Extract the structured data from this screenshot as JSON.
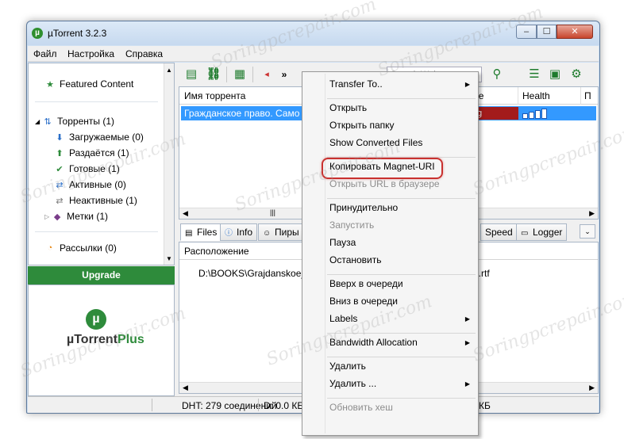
{
  "window": {
    "title": "µTorrent 3.2.3"
  },
  "window_controls": {
    "minimize": "–",
    "maximize": "☐",
    "close": "✕"
  },
  "menubar": [
    "Файл",
    "Настройка",
    "Справка"
  ],
  "sidebar": {
    "featured": "Featured Content",
    "torrents": "Торренты (1)",
    "items": [
      "Загружаемые (0)",
      "Раздаётся (1)",
      "Готовые (1)",
      "Активные (0)",
      "Неактивные (1)",
      "Метки (1)"
    ],
    "feeds": "Рассылки (0)",
    "upgrade": "Upgrade",
    "plus_logo_prefix": "µTorrent",
    "plus_logo_suffix": "Plus"
  },
  "toolbar": {
    "search_placeholder": "Search Web",
    "more": "»"
  },
  "torrent_list": {
    "columns": {
      "name": "Имя торрента",
      "status_partial": "ие",
      "health": "Health",
      "next": "П"
    },
    "row": {
      "name": "Гражданское право. Само",
      "status_partial": "g"
    },
    "health_level": 0.25
  },
  "tabs": {
    "files": "Files",
    "info": "Info",
    "peers": "Пиры",
    "speed": "Speed",
    "logger": "Logger"
  },
  "files": {
    "column": "Расположение",
    "path_start": "D:\\BOOKS\\Grajdanskoe_",
    "path_end": "e.rtf"
  },
  "statusbar": {
    "dht": "DHT: 279 соединений",
    "down": "D: 0.0 КБ",
    "up_partial": "КБ"
  },
  "context_menu": [
    {
      "label": "Transfer To..",
      "submenu": true,
      "disabled": false
    },
    {
      "sep": true
    },
    {
      "label": "Открыть",
      "disabled": false
    },
    {
      "label": "Открыть папку",
      "disabled": false
    },
    {
      "label": "Show Converted Files",
      "disabled": false
    },
    {
      "sep": true
    },
    {
      "label": "Копировать Magnet-URI",
      "disabled": false
    },
    {
      "label": "Открыть URL в браузере",
      "disabled": true
    },
    {
      "sep": true
    },
    {
      "label": "Принудительно",
      "disabled": false
    },
    {
      "label": "Запустить",
      "disabled": true
    },
    {
      "label": "Пауза",
      "disabled": false
    },
    {
      "label": "Остановить",
      "disabled": false
    },
    {
      "sep": true
    },
    {
      "label": "Вверх в очереди",
      "disabled": false
    },
    {
      "label": "Вниз в очереди",
      "disabled": false
    },
    {
      "label": "Labels",
      "submenu": true,
      "disabled": false
    },
    {
      "sep": true
    },
    {
      "label": "Bandwidth Allocation",
      "submenu": true,
      "disabled": false
    },
    {
      "sep": true
    },
    {
      "label": "Удалить",
      "disabled": false
    },
    {
      "label": "Удалить ...",
      "submenu": true,
      "disabled": false
    },
    {
      "sep": true
    },
    {
      "label": "Обновить хеш",
      "disabled": true
    }
  ],
  "watermark": "Soringpcrepair.com",
  "colors": {
    "accent_green": "#2e8b3b",
    "selection_blue": "#3399ff",
    "highlight_red": "#c9312f"
  }
}
